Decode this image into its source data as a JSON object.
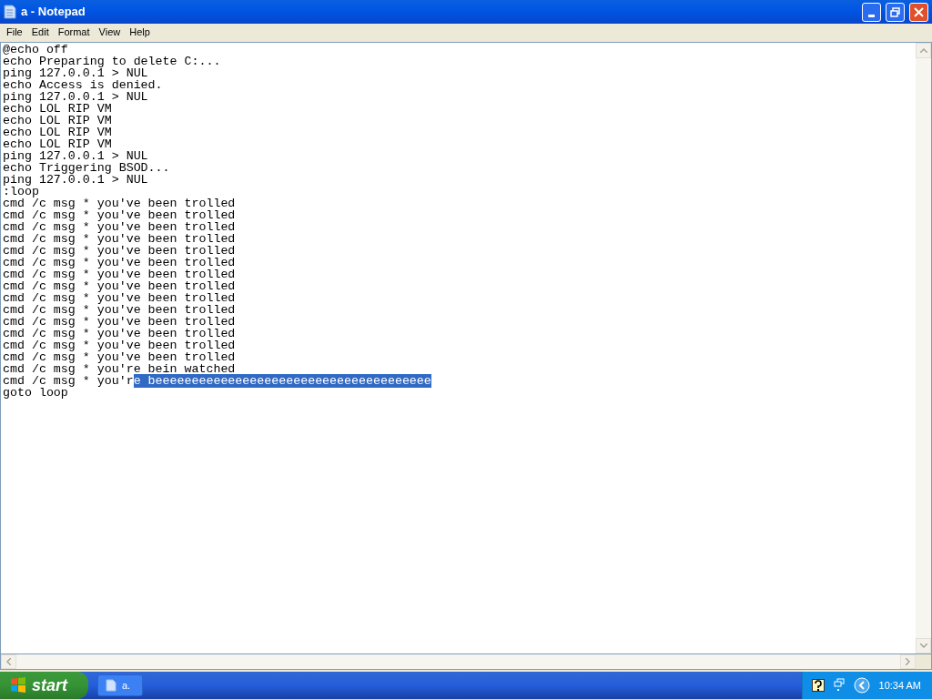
{
  "window": {
    "title": "a - Notepad"
  },
  "menu": [
    "File",
    "Edit",
    "Format",
    "View",
    "Help"
  ],
  "lines": [
    {
      "text": "@echo off"
    },
    {
      "text": "echo Preparing to delete C:..."
    },
    {
      "text": "ping 127.0.0.1 > NUL"
    },
    {
      "text": "echo Access is denied."
    },
    {
      "text": "ping 127.0.0.1 > NUL"
    },
    {
      "text": "echo LOL RIP VM"
    },
    {
      "text": "echo LOL RIP VM"
    },
    {
      "text": "echo LOL RIP VM"
    },
    {
      "text": "echo LOL RIP VM"
    },
    {
      "text": "ping 127.0.0.1 > NUL"
    },
    {
      "text": "echo Triggering BSOD..."
    },
    {
      "text": "ping 127.0.0.1 > NUL"
    },
    {
      "text": ":loop"
    },
    {
      "text": "cmd /c msg * you've been trolled"
    },
    {
      "text": "cmd /c msg * you've been trolled"
    },
    {
      "text": "cmd /c msg * you've been trolled"
    },
    {
      "text": "cmd /c msg * you've been trolled"
    },
    {
      "text": "cmd /c msg * you've been trolled"
    },
    {
      "text": "cmd /c msg * you've been trolled"
    },
    {
      "text": "cmd /c msg * you've been trolled"
    },
    {
      "text": "cmd /c msg * you've been trolled"
    },
    {
      "text": "cmd /c msg * you've been trolled"
    },
    {
      "text": "cmd /c msg * you've been trolled"
    },
    {
      "text": "cmd /c msg * you've been trolled"
    },
    {
      "text": "cmd /c msg * you've been trolled"
    },
    {
      "text": "cmd /c msg * you've been trolled"
    },
    {
      "text": "cmd /c msg * you've been trolled"
    },
    {
      "text": "cmd /c msg * you're bein watched"
    },
    {
      "segments": [
        {
          "text": "cmd /c msg * you'r",
          "selected": false
        },
        {
          "text": "e beeeeeeeeeeeeeeeeeeeeeeeeeeeeeeeeeeeeee",
          "selected": true
        }
      ]
    },
    {
      "text": "goto loop"
    }
  ],
  "taskbar": {
    "start": "start",
    "tasks": [
      {
        "label": "a.",
        "selected": false
      }
    ],
    "clock": "10:34 AM"
  }
}
